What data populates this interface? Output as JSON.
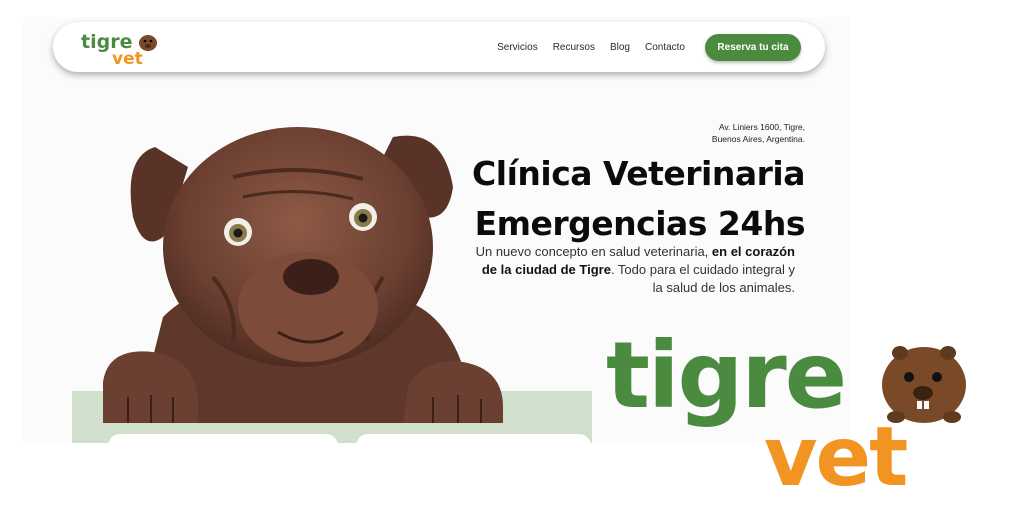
{
  "brand": {
    "name_top": "tigre",
    "name_bottom": "vet",
    "colors": {
      "green": "#4b8b40",
      "orange": "#f29421",
      "band": "#d1e0cd",
      "beaver": "#7a4a28"
    }
  },
  "nav": {
    "links": [
      "Servicios",
      "Recursos",
      "Blog",
      "Contacto"
    ],
    "cta": "Reserva tu cita"
  },
  "hero": {
    "address_line1": "Av. Liniers 1600, Tigre,",
    "address_line2": "Buenos Aires, Argentina.",
    "title_line1": "Clínica Veterinaria",
    "title_line2": "Emergencias 24hs",
    "desc_1": "Un nuevo concepto en salud veterinaria, ",
    "desc_bold": "en el corazón de la ciudad de Tigre",
    "desc_2": ". Todo para el cuidado integral y la salud de los animales."
  },
  "icons": [
    "beaver-mascot-icon",
    "puppy-photo"
  ]
}
